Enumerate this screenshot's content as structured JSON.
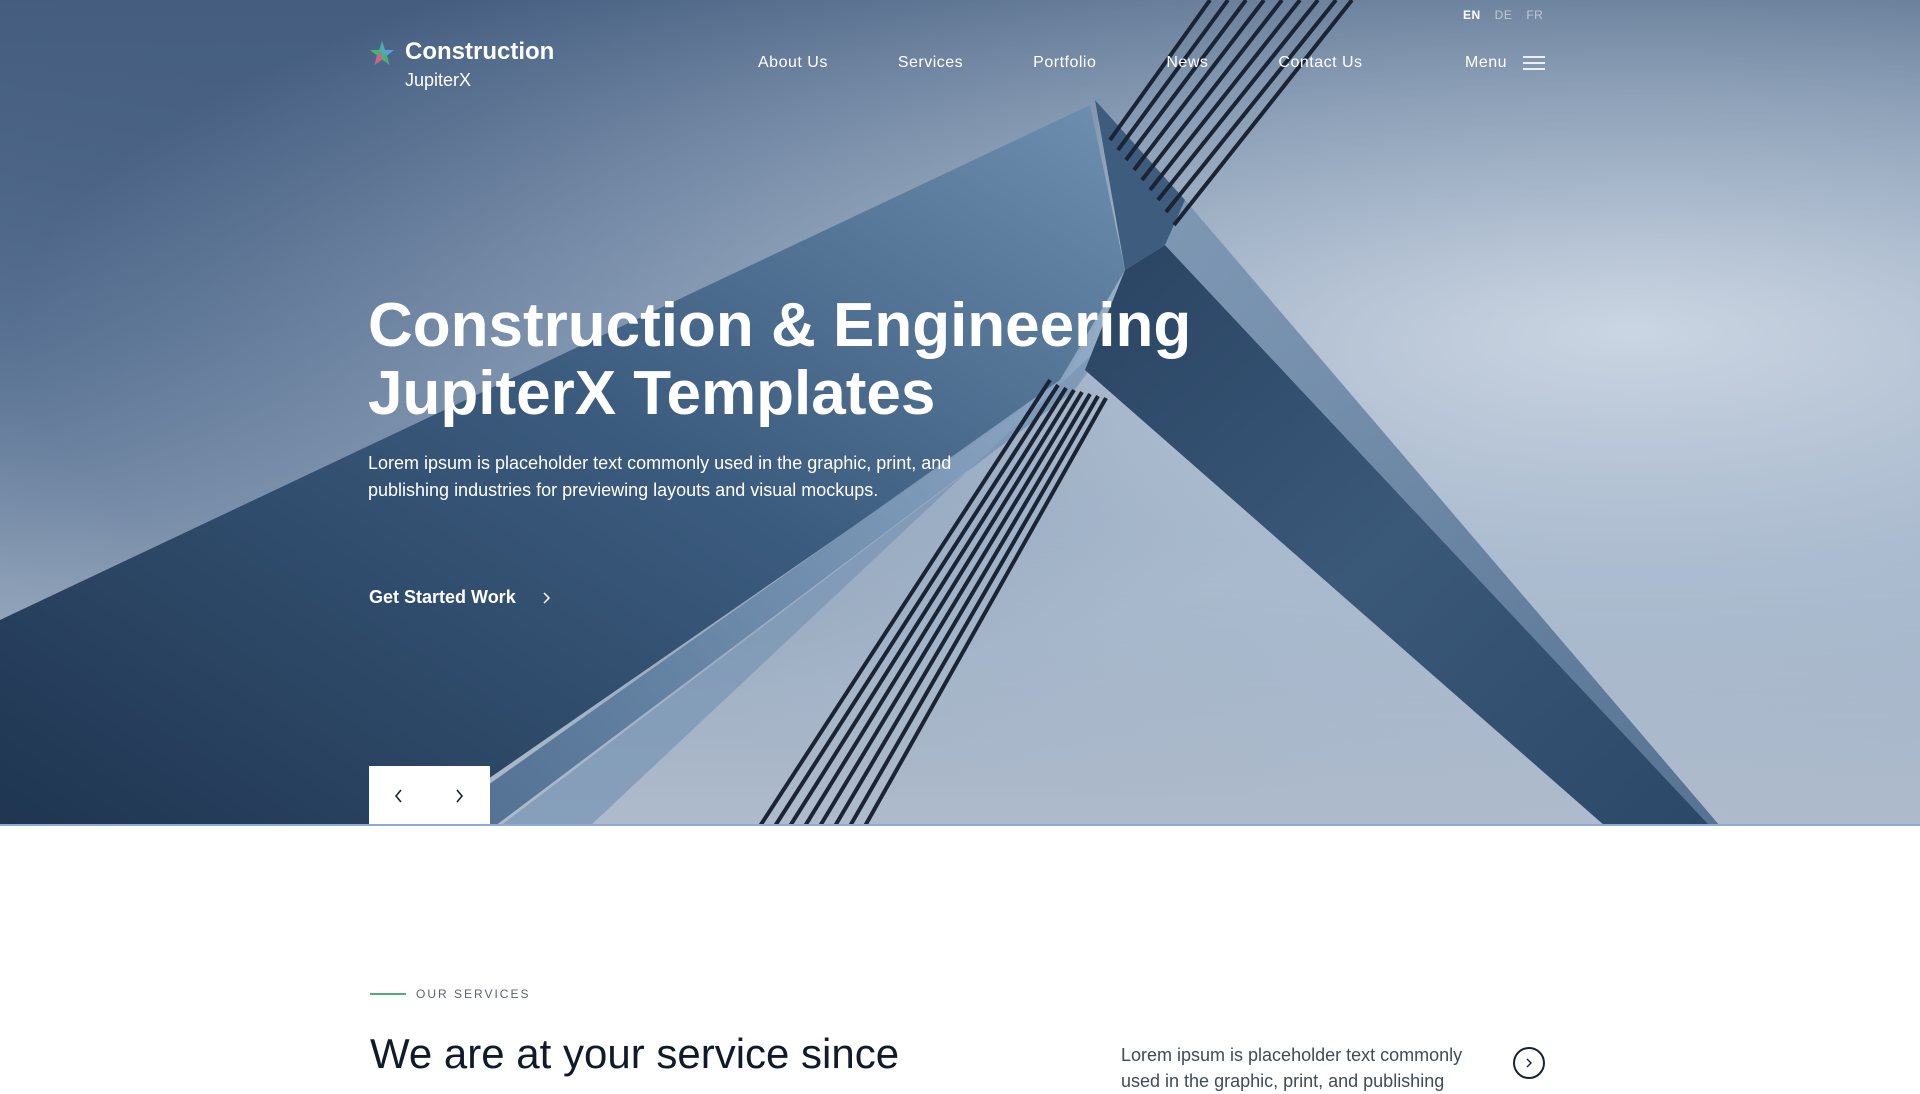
{
  "languages": [
    {
      "label": "EN",
      "active": true
    },
    {
      "label": "DE",
      "active": false
    },
    {
      "label": "FR",
      "active": false
    }
  ],
  "logo": {
    "title": "Construction",
    "subtitle": "JupiterX"
  },
  "nav": [
    "About Us",
    "Services",
    "Portfolio",
    "News",
    "Contact Us"
  ],
  "menu": {
    "label": "Menu",
    "icon": "hamburger-icon"
  },
  "hero": {
    "title_line1": "Construction & Engineering",
    "title_line2": "JupiterX Templates",
    "description": "Lorem ipsum is placeholder text commonly used in the graphic, print, and publishing industries for previewing layouts and visual mockups.",
    "cta_label": "Get Started Work",
    "cta_icon": "chevron-right-icon",
    "prev_icon": "chevron-left-icon",
    "next_icon": "chevron-right-icon"
  },
  "services": {
    "eyebrow": "OUR SERVICES",
    "heading": "We are at your service since",
    "description": "Lorem ipsum is placeholder text commonly used in the graphic, print, and publishing",
    "button_icon": "chevron-right-icon"
  },
  "colors": {
    "accent_green": "#4caf7a",
    "hero_divider": "#8ea8d8",
    "heading_dark": "#0f1a2a"
  }
}
